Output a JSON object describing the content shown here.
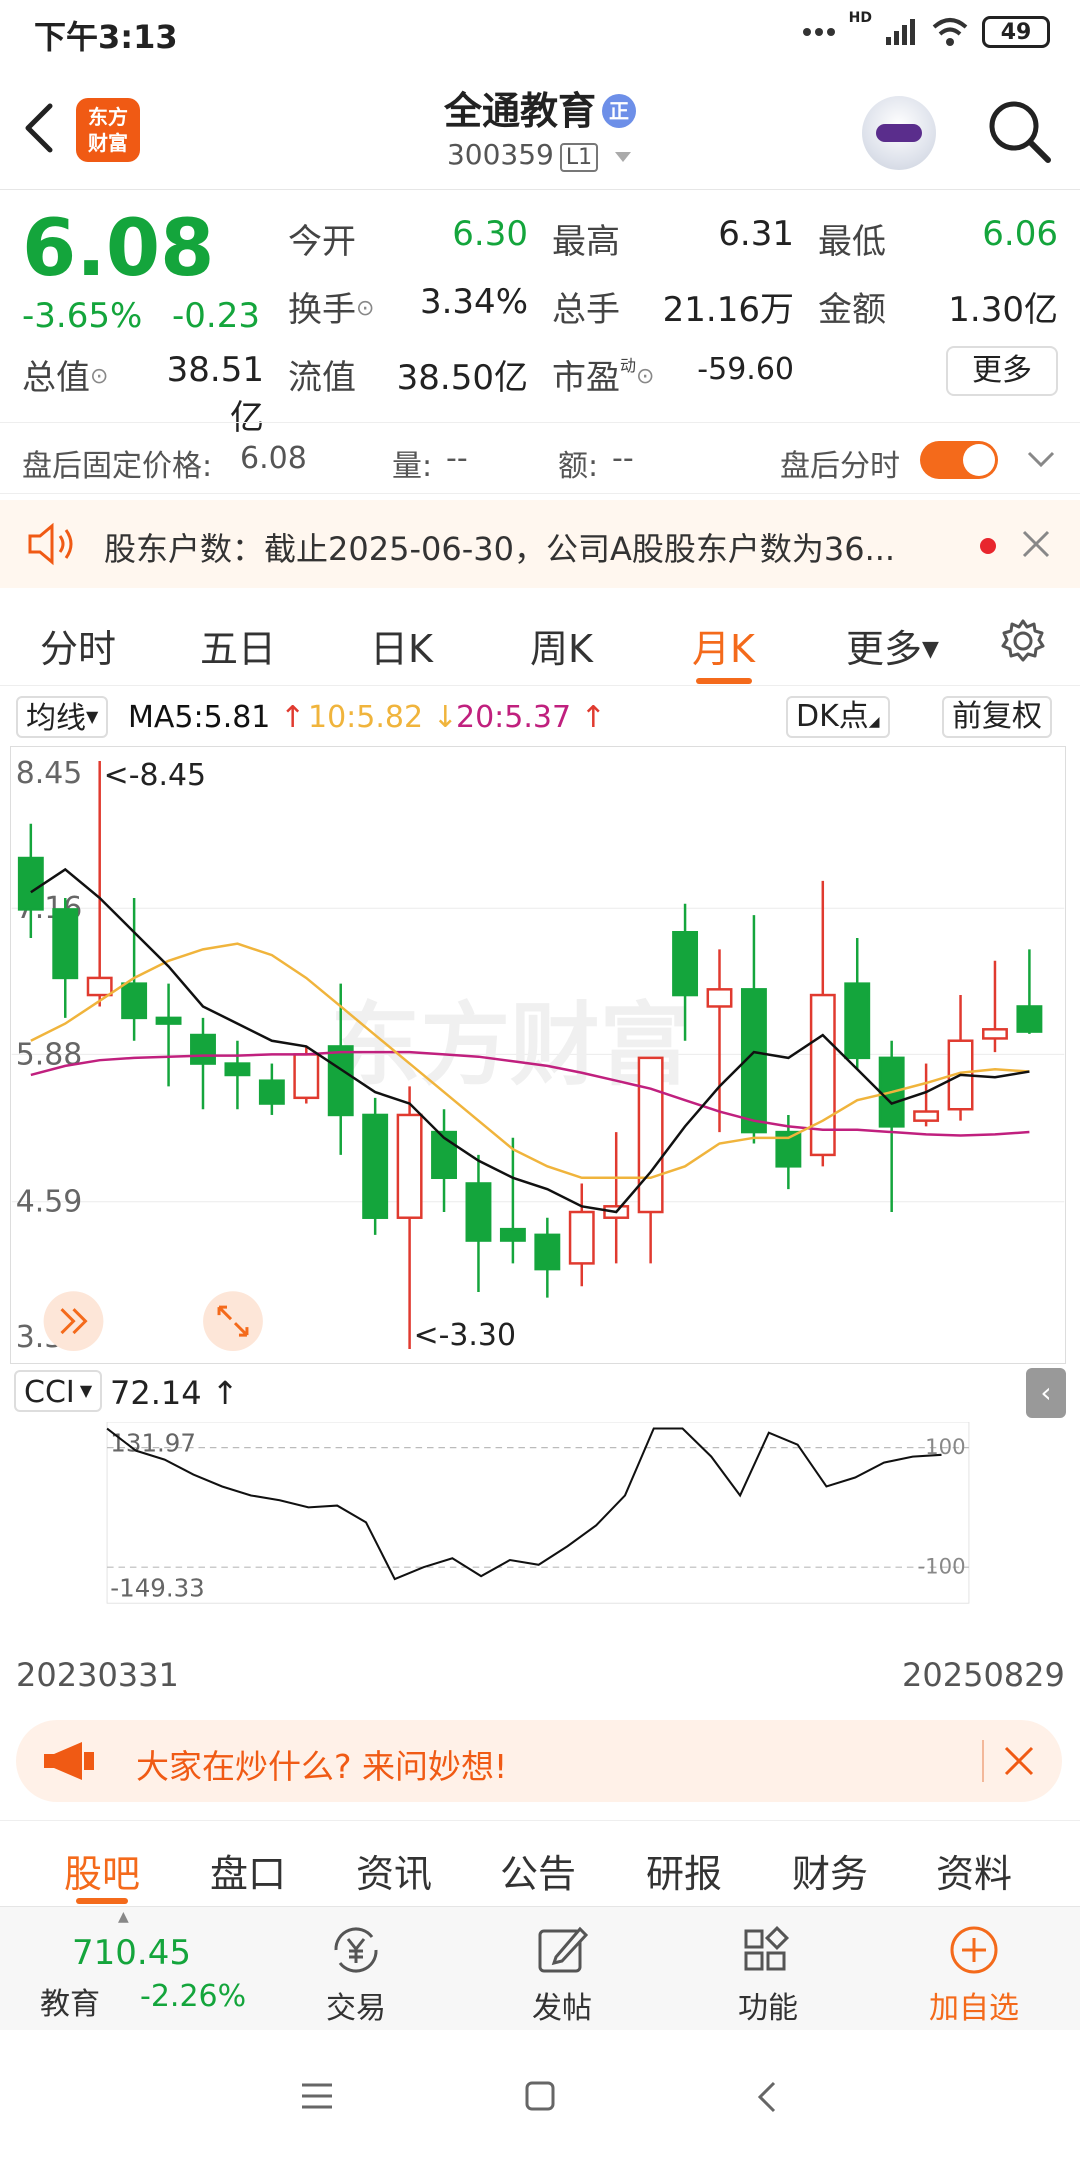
{
  "status_bar": {
    "time": "下午3:13",
    "network": "HD",
    "battery": "49"
  },
  "header": {
    "logo_text_1": "东方",
    "logo_text_2": "财富",
    "stock_name": "全通教育",
    "badge": "正",
    "stock_code": "300359",
    "level": "L1"
  },
  "quote": {
    "price": "6.08",
    "change_pct": "-3.65%",
    "change_abs": "-0.23",
    "fields": [
      {
        "label": "今开",
        "value": "6.30",
        "color": "#14a53c"
      },
      {
        "label": "最高",
        "value": "6.31",
        "color": "#222222"
      },
      {
        "label": "最低",
        "value": "6.06",
        "color": "#14a53c"
      },
      {
        "label": "换手",
        "value": "3.34%",
        "color": "#222222"
      },
      {
        "label": "总手",
        "value": "21.16万",
        "color": "#222222"
      },
      {
        "label": "金额",
        "value": "1.30亿",
        "color": "#222222"
      },
      {
        "label": "总值",
        "value": "38.51亿",
        "color": "#222222"
      },
      {
        "label": "流值",
        "value": "38.50亿",
        "color": "#222222"
      },
      {
        "label": "市盈",
        "value": "-59.60",
        "color": "#222222",
        "superscript": "动"
      }
    ],
    "more_label": "更多"
  },
  "after_hours": {
    "fixed_price_label": "盘后固定价格:",
    "fixed_price": "6.08",
    "volume_label": "量:",
    "volume": "--",
    "amount_label": "额:",
    "amount": "--",
    "timeshare_label": "盘后分时"
  },
  "news": {
    "text": "股东户数：截止2025-06-30，公司A股股东户数为36..."
  },
  "chart_tabs": [
    "分时",
    "五日",
    "日K",
    "周K",
    "月K",
    "更多"
  ],
  "active_chart_tab": "月K",
  "indicators": {
    "ma_select": "均线",
    "ma5": "MA5:5.81",
    "ma10": "10:5.82",
    "ma20": "20:5.37",
    "dk_label": "DK点",
    "adjust_label": "前复权"
  },
  "chart_data": {
    "type": "candlestick",
    "y_axis_ticks": [
      "8.45",
      "7.16",
      "5.88",
      "4.59",
      "3.30"
    ],
    "ylim": [
      3.3,
      8.45
    ],
    "max_annotation": "<-8.45",
    "min_annotation": "<-3.30",
    "x_range_labels": [
      "20230331",
      "20250829"
    ],
    "candles": [
      {
        "o": 7.6,
        "h": 7.9,
        "l": 6.9,
        "c": 7.15
      },
      {
        "o": 7.15,
        "h": 7.25,
        "l": 6.2,
        "c": 6.55
      },
      {
        "o": 6.4,
        "h": 8.45,
        "l": 6.3,
        "c": 6.55
      },
      {
        "o": 6.5,
        "h": 7.25,
        "l": 6.0,
        "c": 6.2
      },
      {
        "o": 6.2,
        "h": 6.5,
        "l": 5.6,
        "c": 6.15
      },
      {
        "o": 6.05,
        "h": 6.2,
        "l": 5.4,
        "c": 5.8
      },
      {
        "o": 5.8,
        "h": 6.0,
        "l": 5.4,
        "c": 5.7
      },
      {
        "o": 5.65,
        "h": 5.8,
        "l": 5.35,
        "c": 5.45
      },
      {
        "o": 5.5,
        "h": 5.95,
        "l": 5.45,
        "c": 5.88
      },
      {
        "o": 5.95,
        "h": 6.5,
        "l": 5.0,
        "c": 5.35
      },
      {
        "o": 5.35,
        "h": 5.5,
        "l": 4.3,
        "c": 4.45
      },
      {
        "o": 4.45,
        "h": 5.6,
        "l": 3.3,
        "c": 5.35
      },
      {
        "o": 5.2,
        "h": 5.4,
        "l": 4.5,
        "c": 4.8
      },
      {
        "o": 4.75,
        "h": 5.0,
        "l": 3.8,
        "c": 4.25
      },
      {
        "o": 4.35,
        "h": 5.15,
        "l": 4.05,
        "c": 4.25
      },
      {
        "o": 4.3,
        "h": 4.45,
        "l": 3.75,
        "c": 4.0
      },
      {
        "o": 4.05,
        "h": 4.75,
        "l": 3.85,
        "c": 4.5
      },
      {
        "o": 4.45,
        "h": 5.2,
        "l": 4.05,
        "c": 4.55
      },
      {
        "o": 4.5,
        "h": 5.7,
        "l": 4.05,
        "c": 5.85
      },
      {
        "o": 6.95,
        "h": 7.2,
        "l": 6.0,
        "c": 6.4
      },
      {
        "o": 6.3,
        "h": 6.8,
        "l": 5.2,
        "c": 6.45
      },
      {
        "o": 6.45,
        "h": 7.1,
        "l": 5.1,
        "c": 5.2
      },
      {
        "o": 5.2,
        "h": 5.35,
        "l": 4.7,
        "c": 4.9
      },
      {
        "o": 5.0,
        "h": 7.4,
        "l": 4.9,
        "c": 6.4
      },
      {
        "o": 6.5,
        "h": 6.9,
        "l": 5.75,
        "c": 5.85
      },
      {
        "o": 5.85,
        "h": 6.0,
        "l": 4.5,
        "c": 5.25
      },
      {
        "o": 5.3,
        "h": 5.8,
        "l": 5.25,
        "c": 5.38
      },
      {
        "o": 5.4,
        "h": 6.4,
        "l": 5.3,
        "c": 6.0
      },
      {
        "o": 6.02,
        "h": 6.7,
        "l": 5.9,
        "c": 6.1
      },
      {
        "o": 6.3,
        "h": 6.8,
        "l": 6.06,
        "c": 6.08
      }
    ],
    "ma5": [
      7.3,
      7.5,
      7.25,
      6.95,
      6.65,
      6.3,
      6.15,
      6.0,
      5.95,
      5.75,
      5.55,
      5.45,
      5.15,
      4.95,
      4.8,
      4.7,
      4.55,
      4.5,
      4.85,
      5.25,
      5.6,
      5.9,
      5.85,
      6.05,
      5.75,
      5.45,
      5.55,
      5.7,
      5.68,
      5.73
    ],
    "ma10": [
      6.0,
      6.15,
      6.35,
      6.55,
      6.7,
      6.8,
      6.85,
      6.75,
      6.55,
      6.3,
      6.05,
      5.8,
      5.55,
      5.3,
      5.05,
      4.9,
      4.8,
      4.8,
      4.8,
      4.9,
      5.1,
      5.15,
      5.15,
      5.3,
      5.48,
      5.55,
      5.63,
      5.72,
      5.75,
      5.73
    ],
    "ma20": [
      5.7,
      5.78,
      5.83,
      5.85,
      5.86,
      5.87,
      5.87,
      5.88,
      5.88,
      5.9,
      5.9,
      5.9,
      5.88,
      5.86,
      5.82,
      5.78,
      5.72,
      5.65,
      5.58,
      5.48,
      5.38,
      5.3,
      5.25,
      5.22,
      5.22,
      5.2,
      5.18,
      5.17,
      5.18,
      5.2
    ]
  },
  "cci": {
    "label": "CCI",
    "value": "72.14",
    "top_tick": "131.97",
    "bottom_tick": "-149.33",
    "ref_high": "100",
    "ref_low": "-100",
    "ylim": [
      -149.33,
      131.97
    ],
    "values": [
      132,
      95,
      80,
      55,
      35,
      20,
      12,
      0,
      3,
      -25,
      -120,
      -100,
      -85,
      -115,
      -88,
      -96,
      -65,
      -30,
      20,
      140,
      135,
      85,
      20,
      125,
      105,
      35,
      50,
      75,
      85,
      88
    ]
  },
  "ask_banner": {
    "text": "大家在炒什么? 来问妙想!"
  },
  "bottom_tabs": [
    "股吧",
    "盘口",
    "资讯",
    "公告",
    "研报",
    "财务",
    "资料"
  ],
  "active_bottom_tab": "股吧",
  "toolbar": {
    "index_value": "710.45",
    "index_name": "教育",
    "index_change": "-2.26%",
    "trade": "交易",
    "post": "发帖",
    "function": "功能",
    "add_watch": "加自选"
  },
  "colors": {
    "up": "#e03a2f",
    "down": "#14a53c",
    "ma5": "#111111",
    "ma10": "#f0b43c",
    "ma20": "#c0207e",
    "accent": "#f46a1b"
  }
}
